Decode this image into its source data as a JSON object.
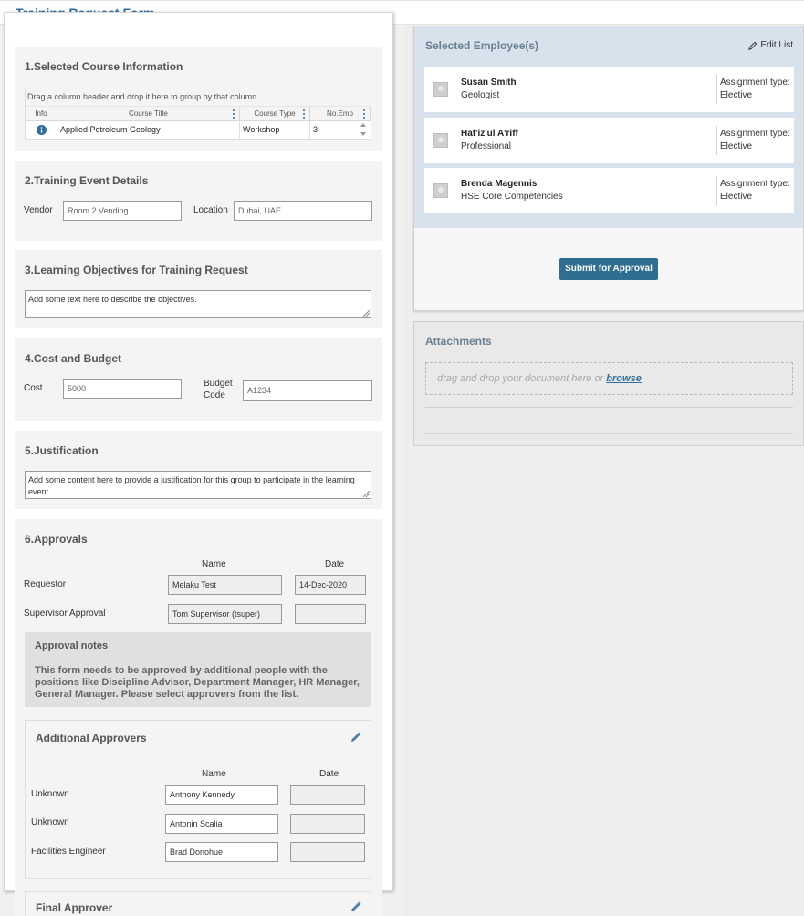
{
  "header": {
    "title": "Training Request Form"
  },
  "course": {
    "title": "1.Selected Course Information",
    "group_hint": "Drag a column header and drop it here to group by that column",
    "columns": [
      "Info",
      "Course Title",
      "Course Type",
      "No.Emp"
    ],
    "row": {
      "title": "Applied Petroleum Geology",
      "type": "Workshop",
      "count": "3"
    }
  },
  "event": {
    "title": "2.Training Event Details",
    "vendor_label": "Vendor",
    "vendor_placeholder": "Room 2 Vending",
    "location_label": "Location",
    "location_placeholder": "Dubai, UAE"
  },
  "objectives": {
    "title": "3.Learning Objectives for Training Request",
    "text": "Add some text here to describe the objectives."
  },
  "budget": {
    "title": "4.Cost and Budget",
    "cost_label": "Cost",
    "cost_placeholder": "5000",
    "code_label_1": "Budget",
    "code_label_2": "Code",
    "code_placeholder": "A1234"
  },
  "justification": {
    "title": "5.Justification",
    "text": "Add some content here to provide a justification for this group to participate in the learning event."
  },
  "approvals": {
    "title": "6.Approvals",
    "name_header": "Name",
    "date_header": "Date",
    "rows": [
      {
        "label": "Requestor",
        "name": "Melaku Test",
        "date": "14-Dec-2020"
      },
      {
        "label": "Supervisor Approval",
        "name": "Tom Supervisor (tsuper)",
        "date": ""
      }
    ],
    "notes_title": "Approval notes",
    "notes_text": "This form needs to be approved by additional people with the positions like Discipline Advisor, Department Manager, HR Manager, General Manager. Please select approvers from the list.",
    "additional": {
      "title": "Additional Approvers",
      "rows": [
        {
          "label": "Unknown",
          "name": "Anthony Kennedy",
          "date": ""
        },
        {
          "label": "Unknown",
          "name": "Antonin Scalia",
          "date": ""
        },
        {
          "label": "Facilities Engineer",
          "name": "Brad Donohue",
          "date": ""
        }
      ]
    },
    "final": {
      "title": "Final Approver"
    }
  },
  "employees": {
    "title": "Selected Employee(s)",
    "edit_label": "Edit List",
    "items": [
      {
        "name": "Susan Smith",
        "role": "Geologist",
        "assign_label": "Assignment type:",
        "assign_value": "Elective"
      },
      {
        "name": "Haf'iz'ul A'riff",
        "role": "Professional",
        "assign_label": "Assignment type:",
        "assign_value": "Elective"
      },
      {
        "name": "Brenda Magennis",
        "role": "HSE Core Competencies",
        "assign_label": "Assignment type:",
        "assign_value": "Elective"
      }
    ],
    "submit_label": "Submit for Approval"
  },
  "attachments": {
    "title": "Attachments",
    "drop_text": "drag and drop your document here or",
    "browse_label": "browse"
  },
  "colors": {
    "accent": "#2f6d9f",
    "button": "#2f6d91",
    "panel_blue": "#d7e2ec"
  },
  "icons": [
    "info-icon",
    "pencil-icon",
    "avatar-icon",
    "kebab-menu-icon",
    "scroll-arrow-icon",
    "resize-grip-icon"
  ]
}
